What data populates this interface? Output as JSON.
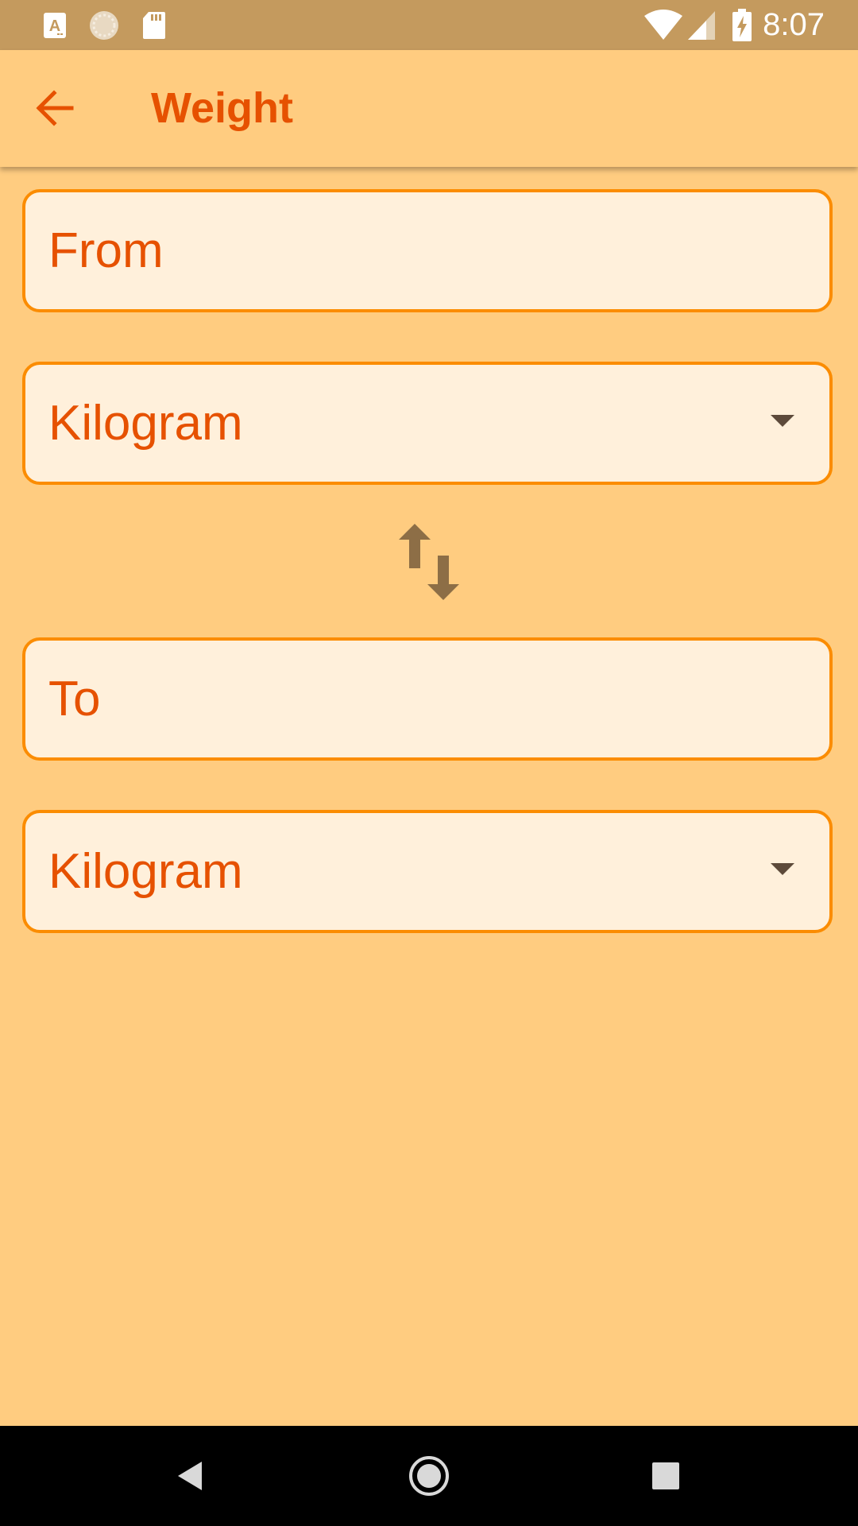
{
  "status_bar": {
    "time": "8:07",
    "icons": [
      "text-a-notification-icon",
      "sync-circle-icon",
      "sd-card-icon",
      "wifi-icon",
      "signal-icon",
      "battery-charging-icon"
    ]
  },
  "app_bar": {
    "title": "Weight",
    "back_icon": "arrow-left-icon"
  },
  "converter": {
    "from_placeholder": "From",
    "from_unit": "Kilogram",
    "swap_icon": "swap-vertical-icon",
    "to_placeholder": "To",
    "to_unit": "Kilogram"
  },
  "nav_bar": {
    "icons": [
      "nav-back-icon",
      "nav-home-icon",
      "nav-recents-icon"
    ]
  },
  "colors": {
    "status_bar_bg": "#C49A5E",
    "background": "#FFCC80",
    "accent": "#E65100",
    "field_border": "#FB8C00",
    "field_bg": "#FFF0DB",
    "icon_brown": "#8D6E46"
  }
}
